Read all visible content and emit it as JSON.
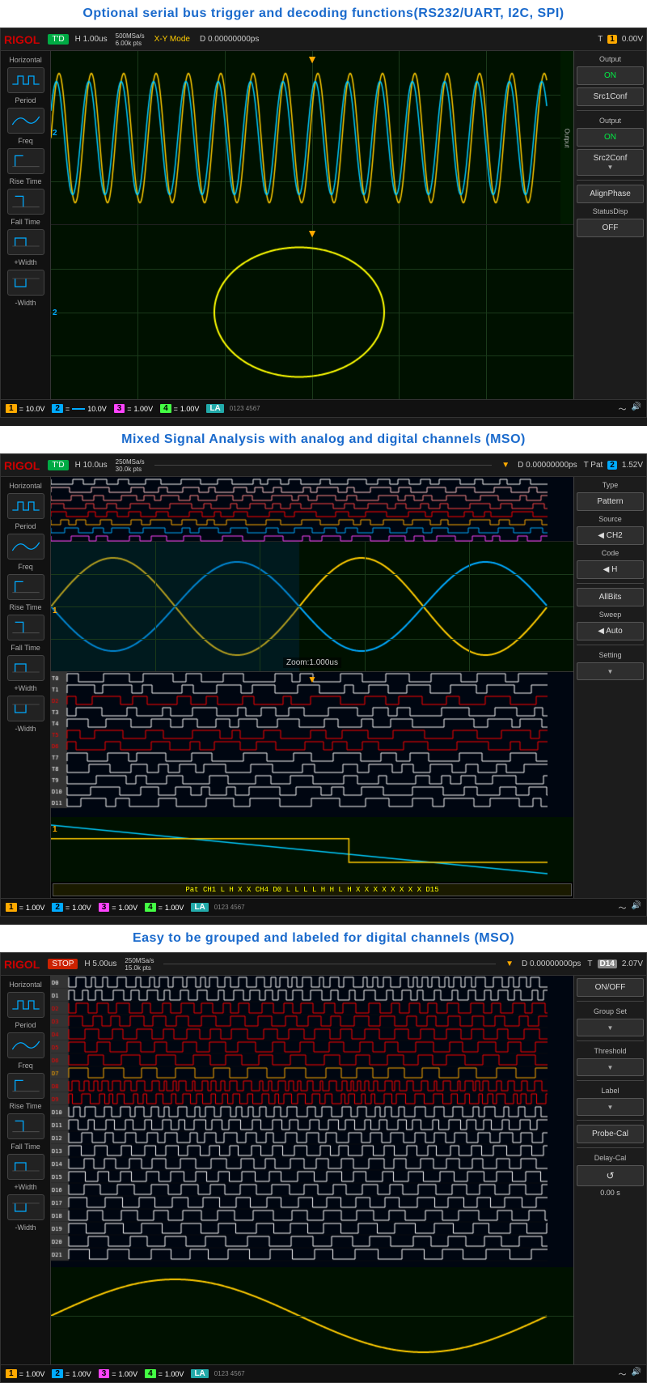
{
  "sections": [
    {
      "header": "Optional serial bus trigger and decoding functions(RS232/UART, I2C, SPI)",
      "scope": {
        "logo": "RIGOL",
        "badge": "T'D",
        "badge_color": "green",
        "h_val": "H  1.00us",
        "sample_rate": "500MSa/s\n6.00k pts",
        "mode": "X-Y Mode",
        "d_val": "D  0.00000000ps",
        "t_val": "T",
        "ch_val": "1",
        "volt": "0.00V",
        "sidebar_items": [
          {
            "label": "Output"
          },
          {
            "label": "ON",
            "color": "green"
          },
          {
            "label": "Src1Conf",
            "has_arrow": false
          },
          {
            "label": "Output"
          },
          {
            "label": "ON",
            "color": "green"
          },
          {
            "label": "Src2Conf",
            "has_arrow": true
          },
          {
            "label": "AlignPhase"
          },
          {
            "label": "StatusDisp"
          },
          {
            "label": "OFF"
          }
        ],
        "left_items": [
          "Horizontal",
          "Period",
          "Freq",
          "Rise Time",
          "Fall Time",
          "+Width",
          "-Width"
        ],
        "ch_bars": [
          {
            "num": "1",
            "color": "#ffaa00",
            "val": "10.0V"
          },
          {
            "num": "2",
            "color": "#00aaff",
            "val": "10.0V"
          },
          {
            "num": "3",
            "color": "#ff44ff",
            "val": "1.00V"
          },
          {
            "num": "4",
            "color": "#44ff44",
            "val": "1.00V"
          }
        ]
      }
    },
    {
      "header": "Mixed Signal Analysis with analog and digital channels (MSO)",
      "scope": {
        "logo": "RIGOL",
        "badge": "T'D",
        "badge_color": "green",
        "h_val": "H  10.0us",
        "sample_rate": "250MSa/s\n30.0k pts",
        "d_val": "D  0.00000000ps",
        "t_val": "T Pat",
        "ch_val": "2",
        "volt": "1.52V",
        "sidebar_items": [
          {
            "label": "Type"
          },
          {
            "label": "Pattern"
          },
          {
            "label": "Source"
          },
          {
            "label": "CH2"
          },
          {
            "label": "Code"
          },
          {
            "label": "H"
          },
          {
            "label": "AllBits"
          },
          {
            "label": "Sweep"
          },
          {
            "label": "Auto"
          },
          {
            "label": "Setting",
            "has_arrow": true
          }
        ],
        "left_items": [
          "Horizontal",
          "Period",
          "Freq",
          "Rise Time",
          "Fall Time",
          "+Width",
          "-Width"
        ],
        "ch_bars": [
          {
            "num": "1",
            "color": "#ffaa00",
            "val": "1.00V"
          },
          {
            "num": "2",
            "color": "#00aaff",
            "val": "1.00V"
          },
          {
            "num": "3",
            "color": "#ff44ff",
            "val": "1.00V"
          },
          {
            "num": "4",
            "color": "#44ff44",
            "val": "1.00V"
          }
        ],
        "zoom_label": "Zoom:1.000us",
        "pattern_text": "Pat  CH1 L H X X  CH4 D0 L L L L H H L H X X X X X X X X  D15"
      }
    },
    {
      "header": "Easy to be grouped and labeled for digital channels (MSO)",
      "scope": {
        "logo": "RIGOL",
        "badge": "STOP",
        "badge_color": "red",
        "h_val": "H  5.00us",
        "sample_rate": "250MSa/s\n15.0k pts",
        "d_val": "D  0.00000000ps",
        "t_val": "T",
        "ch_val": "D14",
        "volt": "2.07V",
        "sidebar_items": [
          {
            "label": "ON/OFF"
          },
          {
            "label": "Group Set",
            "has_arrow": true
          },
          {
            "label": "Threshold",
            "has_arrow": true
          },
          {
            "label": "Label",
            "has_arrow": true
          },
          {
            "label": "Probe-Cal"
          },
          {
            "label": "Delay-Cal"
          },
          {
            "label": "0.00 s",
            "small": true
          }
        ],
        "left_items": [
          "Horizontal",
          "Period",
          "Freq",
          "Rise Time",
          "Fall Time",
          "+Width",
          "-Width"
        ],
        "ch_bars": [
          {
            "num": "1",
            "color": "#ffaa00",
            "val": "1.00V"
          },
          {
            "num": "2",
            "color": "#00aaff",
            "val": "1.00V"
          },
          {
            "num": "3",
            "color": "#ff44ff",
            "val": "1.00V"
          },
          {
            "num": "4",
            "color": "#44ff44",
            "val": "1.00V"
          }
        ]
      }
    }
  ]
}
